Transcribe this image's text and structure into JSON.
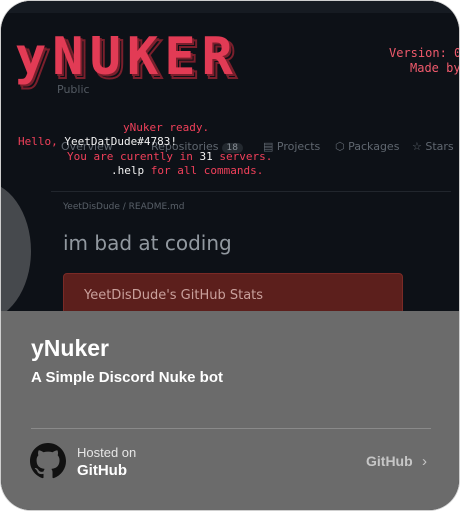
{
  "background": {
    "github": {
      "nav_text": "Public",
      "tabs": [
        {
          "label": "Overview"
        },
        {
          "label": "Repositories",
          "count": "18"
        },
        {
          "label": "Projects"
        },
        {
          "label": "Packages"
        },
        {
          "label": "Stars"
        }
      ],
      "readme_path": "YeetDisDude / README.md",
      "heading": "im bad at coding",
      "stats_label": "YeetDisDude's GitHub Stats"
    },
    "terminal": {
      "logo_text": "yNUKER",
      "version_line": "Version: 0",
      "made_by_line": "Made by",
      "ready_line": "yNuker ready.",
      "hello_prefix": "Hello,",
      "username": "YeetDatDude#4783",
      "hello_suffix": "!",
      "servers_prefix": "You are curently in",
      "servers_count": "31",
      "servers_suffix": "servers.",
      "help_cmd": ".help",
      "help_suffix": "for all commands."
    }
  },
  "card": {
    "title": "yNuker",
    "subtitle": "A Simple Discord Nuke bot",
    "hosted_label": "Hosted on",
    "host_name": "GitHub",
    "link_label": "GitHub",
    "link_chevron": "›",
    "host_icon": "github-octocat-icon"
  },
  "colors": {
    "terminal_red": "#f0405a",
    "overlay_gray": "#6b6b6b",
    "background_dark": "#0d1117"
  }
}
